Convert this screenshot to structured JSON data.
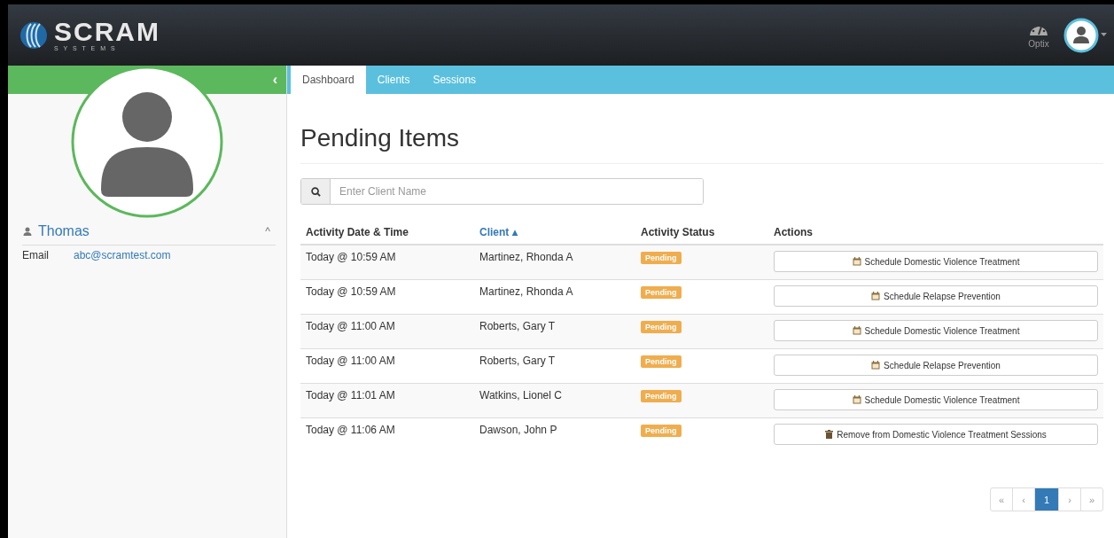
{
  "header": {
    "logo": {
      "name": "SCRAM",
      "tagline": "S Y S T E M S"
    },
    "optix_label": "Optix"
  },
  "sidebar": {
    "collapse_glyph": "‹",
    "user": {
      "name": "Thomas",
      "expanded": true,
      "expand_glyph": "^"
    },
    "details": [
      {
        "label": "Email",
        "value": "abc@scramtest.com"
      }
    ]
  },
  "tabs": [
    {
      "label": "Dashboard",
      "selected": true
    },
    {
      "label": "Clients",
      "selected": false
    },
    {
      "label": "Sessions",
      "selected": false
    }
  ],
  "page_title": "Pending Items",
  "search": {
    "placeholder": "Enter Client Name"
  },
  "table": {
    "columns": [
      {
        "label": "Activity Date & Time",
        "sorted": false
      },
      {
        "label": "Client",
        "sorted": true,
        "sort_glyph": "▴"
      },
      {
        "label": "Activity Status",
        "sorted": false
      },
      {
        "label": "Actions",
        "sorted": false
      }
    ],
    "rows": [
      {
        "time": "Today @ 10:59 AM",
        "client": "Martinez, Rhonda A",
        "status": "Pending",
        "action": {
          "kind": "schedule",
          "label": "Schedule Domestic Violence Treatment"
        }
      },
      {
        "time": "Today @ 10:59 AM",
        "client": "Martinez, Rhonda A",
        "status": "Pending",
        "action": {
          "kind": "schedule",
          "label": "Schedule Relapse Prevention"
        }
      },
      {
        "time": "Today @ 11:00 AM",
        "client": "Roberts, Gary T",
        "status": "Pending",
        "action": {
          "kind": "schedule",
          "label": "Schedule Domestic Violence Treatment"
        }
      },
      {
        "time": "Today @ 11:00 AM",
        "client": "Roberts, Gary T",
        "status": "Pending",
        "action": {
          "kind": "schedule",
          "label": "Schedule Relapse Prevention"
        }
      },
      {
        "time": "Today @ 11:01 AM",
        "client": "Watkins, Lionel C",
        "status": "Pending",
        "action": {
          "kind": "schedule",
          "label": "Schedule Domestic Violence Treatment"
        }
      },
      {
        "time": "Today @ 11:06 AM",
        "client": "Dawson, John P",
        "status": "Pending",
        "action": {
          "kind": "remove",
          "label": "Remove from Domestic Violence Treatment Sessions"
        }
      }
    ]
  },
  "pagination": [
    {
      "label": "«",
      "selected": false
    },
    {
      "label": "‹",
      "selected": false
    },
    {
      "label": "1",
      "selected": true
    },
    {
      "label": "›",
      "selected": false
    },
    {
      "label": "»",
      "selected": false
    }
  ]
}
